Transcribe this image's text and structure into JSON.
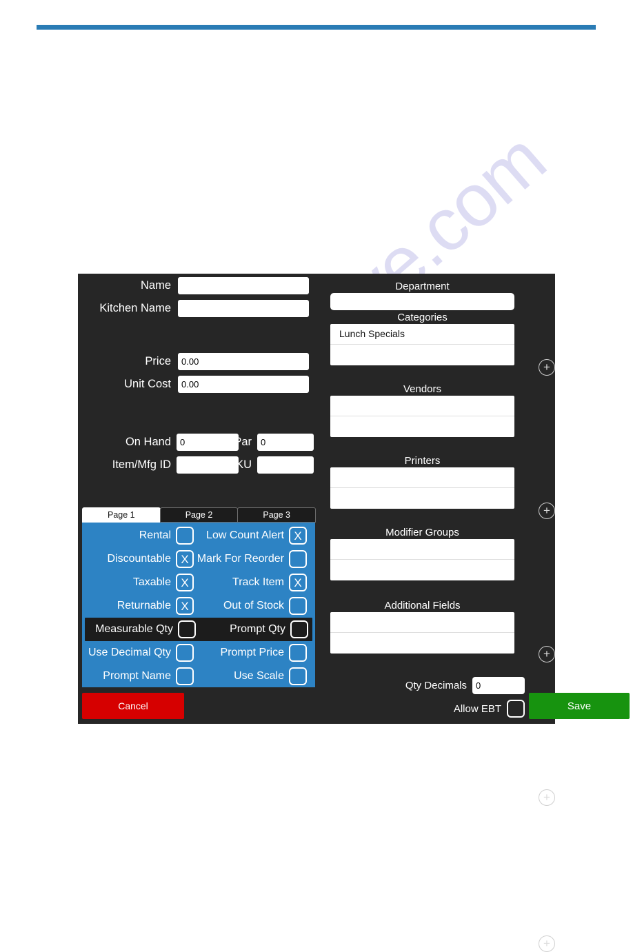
{
  "page": {
    "watermark_text": "manualshive.com",
    "header_rule_color": "#2a7cb5"
  },
  "dialog": {
    "background_color": "#262626",
    "left": {
      "fields": [
        {
          "label": "Name",
          "value": "",
          "name": "name"
        },
        {
          "label": "Kitchen Name",
          "value": "",
          "name": "kitchen-name"
        },
        {
          "label": "Price",
          "value": "0.00",
          "name": "price"
        },
        {
          "label": "Unit Cost",
          "value": "0.00",
          "name": "unit-cost"
        },
        {
          "label": "On Hand",
          "value": "0",
          "name": "on-hand"
        },
        {
          "label": "Par",
          "value": "0",
          "name": "par"
        },
        {
          "label": "Item/Mfg ID",
          "value": "",
          "name": "item-mfg-id"
        },
        {
          "label": "SKU",
          "value": "",
          "name": "sku"
        }
      ]
    },
    "tabs": {
      "items": [
        {
          "label": "Page 1",
          "active": true
        },
        {
          "label": "Page 2",
          "active": false
        },
        {
          "label": "Page 3",
          "active": false
        }
      ]
    },
    "options": {
      "panel_color": "#2d83c4",
      "rows": [
        {
          "highlighted": false,
          "left": {
            "label": "Rental",
            "checked": false
          },
          "right": {
            "label": "Low Count Alert",
            "checked": true
          }
        },
        {
          "highlighted": false,
          "left": {
            "label": "Discountable",
            "checked": true
          },
          "right": {
            "label": "Mark For Reorder",
            "checked": false
          }
        },
        {
          "highlighted": false,
          "left": {
            "label": "Taxable",
            "checked": true
          },
          "right": {
            "label": "Track Item",
            "checked": true
          }
        },
        {
          "highlighted": false,
          "left": {
            "label": "Returnable",
            "checked": true
          },
          "right": {
            "label": "Out of Stock",
            "checked": false
          }
        },
        {
          "highlighted": true,
          "left": {
            "label": "Measurable Qty",
            "checked": false
          },
          "right": {
            "label": "Prompt Qty",
            "checked": false
          }
        },
        {
          "highlighted": false,
          "left": {
            "label": "Use Decimal Qty",
            "checked": false
          },
          "right": {
            "label": "Prompt Price",
            "checked": false
          }
        },
        {
          "highlighted": false,
          "left": {
            "label": "Prompt Name",
            "checked": false
          },
          "right": {
            "label": "Use Scale",
            "checked": false
          }
        }
      ],
      "checked_glyph": "X"
    },
    "right": {
      "department": {
        "title": "Department",
        "value": ""
      },
      "categories": {
        "title": "Categories",
        "items": [
          "Lunch Specials",
          ""
        ],
        "add_icon": "+"
      },
      "vendors": {
        "title": "Vendors",
        "items": [
          "",
          ""
        ],
        "add_icon": "+"
      },
      "printers": {
        "title": "Printers",
        "items": [
          "",
          ""
        ],
        "add_icon": "+"
      },
      "modifier_groups": {
        "title": "Modifier Groups",
        "items": [
          "",
          ""
        ],
        "add_icon": "+"
      },
      "additional_fields": {
        "title": "Additional Fields",
        "items": [
          "",
          ""
        ],
        "add_icon": "+"
      },
      "qty_decimals": {
        "label": "Qty Decimals",
        "value": "0"
      },
      "allow_ebt": {
        "label": "Allow EBT",
        "checked": false
      }
    },
    "buttons": {
      "cancel": {
        "label": "Cancel",
        "color": "#d60000"
      },
      "save": {
        "label": "Save",
        "color": "#17930f"
      }
    }
  }
}
